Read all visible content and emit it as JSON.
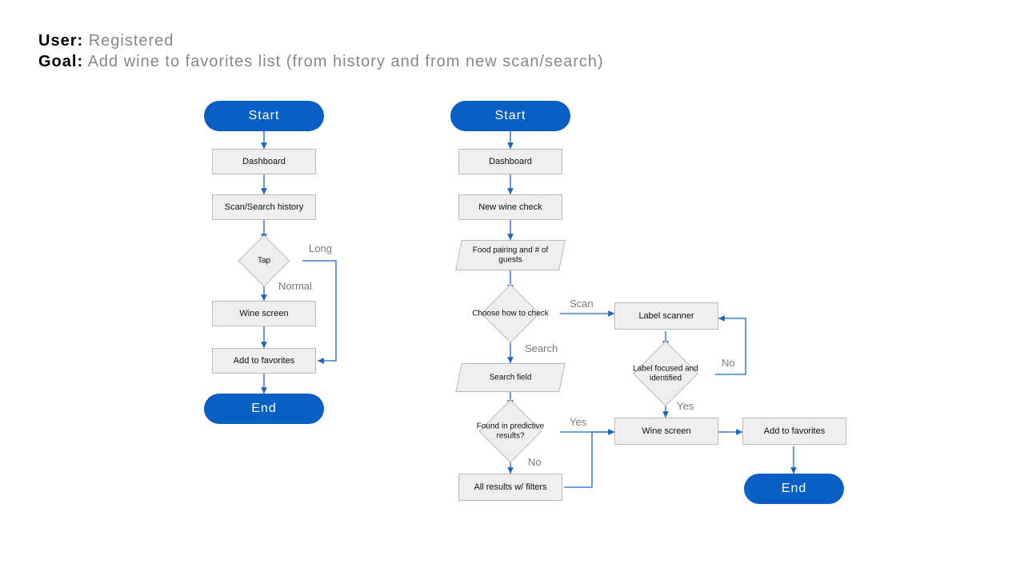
{
  "header": {
    "user_label": "User:",
    "user_value": "Registered",
    "goal_label": "Goal:",
    "goal_value": "Add wine to favorites list (from history and from new scan/search)"
  },
  "colors": {
    "accent": "#0a5fc4",
    "box_fill": "#eeeeee",
    "box_stroke": "#bbbbbb",
    "edge_label": "#7a7a7a",
    "line": "#1b64be"
  },
  "left_flow": {
    "start": "Start",
    "dashboard": "Dashboard",
    "history": "Scan/Search history",
    "tap": "Tap",
    "tap_long": "Long",
    "tap_normal": "Normal",
    "wine_screen": "Wine screen",
    "add_fav": "Add to favorites",
    "end": "End"
  },
  "right_flow": {
    "start": "Start",
    "dashboard": "Dashboard",
    "new_check": "New wine check",
    "food_guests": "Food pairing and # of guests",
    "choose": "Choose how to check",
    "choose_scan": "Scan",
    "choose_search": "Search",
    "search_field": "Search field",
    "found": "Found in predictive results?",
    "found_yes": "Yes",
    "found_no": "No",
    "all_results": "All results w/ filters",
    "label_scanner": "Label scanner",
    "label_id": "Label focused and identified",
    "label_no": "No",
    "label_yes": "Yes",
    "wine_screen": "Wine screen",
    "add_fav": "Add to favorites",
    "end": "End"
  }
}
